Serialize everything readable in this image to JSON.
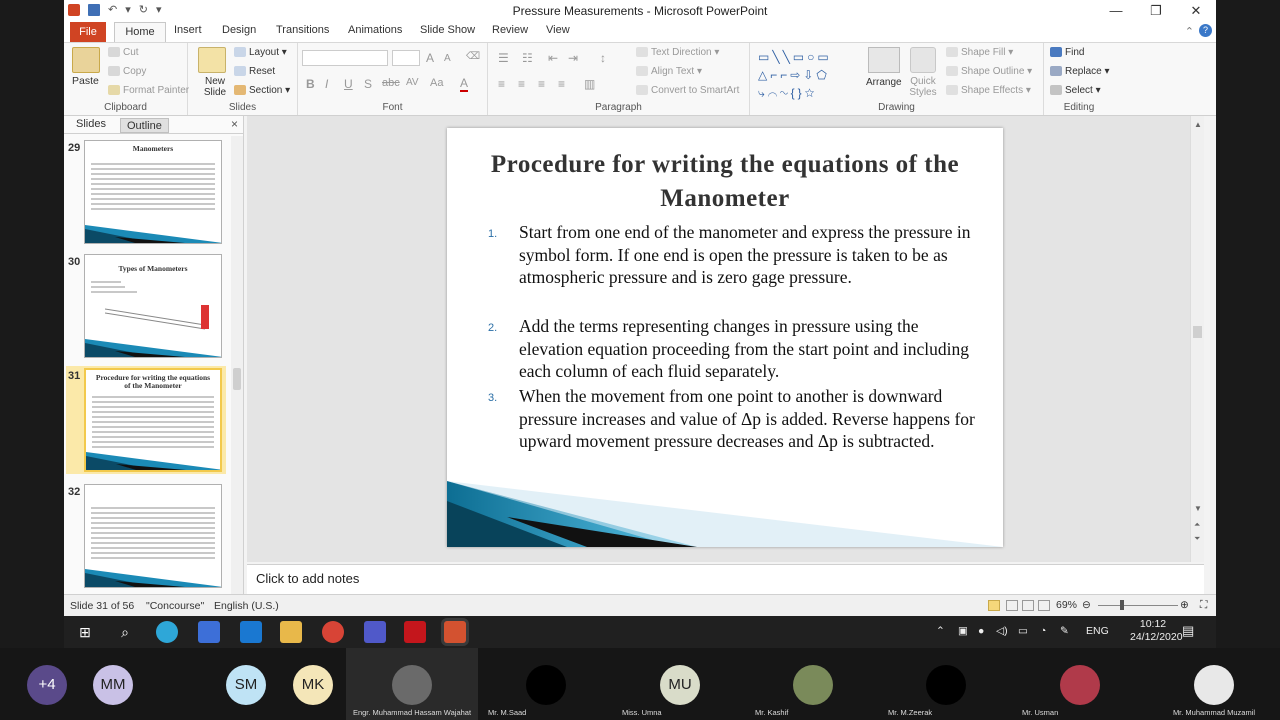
{
  "window_title": "Pressure Measurements - Microsoft PowerPoint",
  "tabs": [
    "File",
    "Home",
    "Insert",
    "Design",
    "Transitions",
    "Animations",
    "Slide Show",
    "Review",
    "View"
  ],
  "ribbon": {
    "clipboard": {
      "paste": "Paste",
      "cut": "Cut",
      "copy": "Copy",
      "format_painter": "Format Painter",
      "label": "Clipboard"
    },
    "slides": {
      "new_slide": "New Slide",
      "layout": "Layout",
      "reset": "Reset",
      "section": "Section",
      "label": "Slides"
    },
    "font": {
      "label": "Font",
      "bold": "B",
      "italic": "I",
      "underline": "U",
      "strike": "S",
      "spacing": "AV",
      "size_up": "A",
      "size_down": "A",
      "case": "Aa",
      "color": "A"
    },
    "paragraph": {
      "text_direction": "Text Direction",
      "align_text": "Align Text",
      "convert_smartart": "Convert to SmartArt",
      "label": "Paragraph"
    },
    "drawing": {
      "arrange": "Arrange",
      "quick_styles": "Quick Styles",
      "shape_fill": "Shape Fill",
      "shape_outline": "Shape Outline",
      "shape_effects": "Shape Effects",
      "label": "Drawing"
    },
    "editing": {
      "find": "Find",
      "replace": "Replace",
      "select": "Select",
      "label": "Editing"
    }
  },
  "panel": {
    "tab_slides": "Slides",
    "tab_outline": "Outline",
    "close": "×"
  },
  "thumbnails": [
    {
      "num": "29",
      "title": "Manometers"
    },
    {
      "num": "30",
      "title": "Types of Manometers"
    },
    {
      "num": "31",
      "title": "Procedure for writing the equations of the Manometer"
    },
    {
      "num": "32",
      "title": ""
    }
  ],
  "slide": {
    "title": "Procedure for writing the equations of the Manometer",
    "items": [
      {
        "num": "1.",
        "text": "Start from one end of the manometer and express the pressure in symbol form. If one end is open the pressure is taken to be as atmospheric pressure and is zero gage pressure."
      },
      {
        "num": "2.",
        "text": "Add the terms representing changes in pressure using the elevation equation proceeding from the start point and including each column of each fluid separately."
      },
      {
        "num": "3.",
        "text": "When the movement from one point to another is downward pressure increases and value of Δp is added. Reverse happens for upward movement pressure decreases and Δp is subtracted."
      }
    ]
  },
  "notes_placeholder": "Click to add notes",
  "status": {
    "slide": "Slide 31 of 56",
    "theme": "\"Concourse\"",
    "language": "English (U.S.)",
    "zoom": "69%"
  },
  "taskbar": {
    "lang": "ENG",
    "time": "10:12",
    "date": "24/12/2020"
  },
  "participants": [
    {
      "initials": "+4",
      "name": "",
      "color": "#5a4a8a"
    },
    {
      "initials": "MM",
      "name": "",
      "color": "#c9c1e6"
    },
    {
      "initials": "SM",
      "name": "",
      "color": "#bfe3f5"
    },
    {
      "initials": "MK",
      "name": "",
      "color": "#f4e6b8"
    },
    {
      "initials": "",
      "name": "Engr. Muhammad Hassam Wajahat",
      "color": "#6a6a6a"
    },
    {
      "initials": "",
      "name": "Mr. M.Saad",
      "color": "#000000"
    },
    {
      "initials": "MU",
      "name": "Miss. Umna",
      "color": "#d9dcc9"
    },
    {
      "initials": "",
      "name": "Mr. Kashif",
      "color": "#7a8a5a"
    },
    {
      "initials": "",
      "name": "Mr. M.Zeerak",
      "color": "#000000"
    },
    {
      "initials": "",
      "name": "Mr. Usman",
      "color": "#b03a4a"
    },
    {
      "initials": "",
      "name": "Mr. Muhammad Muzamil",
      "color": "#e8e8e8"
    }
  ]
}
